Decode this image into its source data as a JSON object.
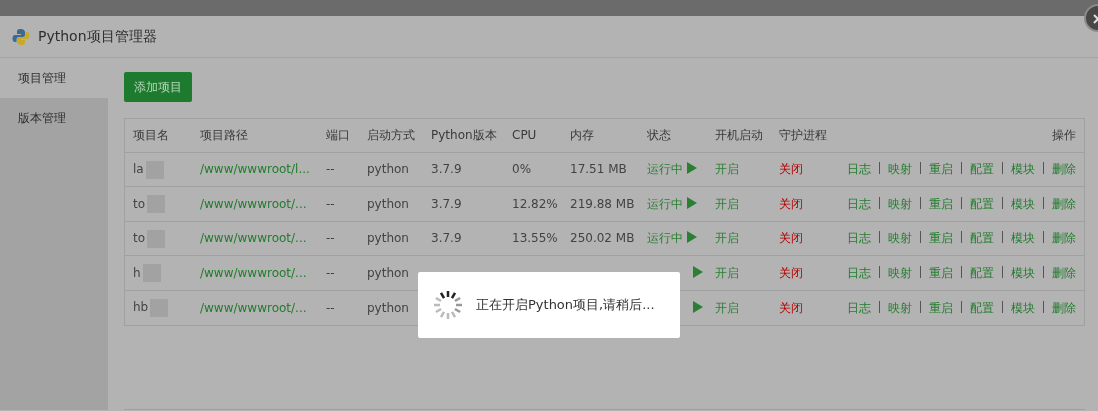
{
  "window": {
    "title": "Python项目管理器"
  },
  "sidebar": {
    "items": [
      {
        "label": "项目管理",
        "selected": true
      },
      {
        "label": "版本管理",
        "selected": false
      }
    ]
  },
  "add_button": "添加项目",
  "table": {
    "columns": [
      "项目名",
      "项目路径",
      "端口",
      "启动方式",
      "Python版本",
      "CPU",
      "内存",
      "状态",
      "开机启动",
      "守护进程",
      "操作"
    ],
    "rows": [
      {
        "name": "la",
        "path": "/www/wwwroot/l...",
        "port": "--",
        "start_mode": "python",
        "version": "3.7.9",
        "cpu": "0%",
        "memory": "17.51 MB",
        "status": "运行中",
        "running": true,
        "autostart": "开启",
        "daemon": "关闭",
        "actions": [
          "日志",
          "映射",
          "重启",
          "配置",
          "模块",
          "删除"
        ]
      },
      {
        "name": "to",
        "path": "/www/wwwroot/...",
        "port": "--",
        "start_mode": "python",
        "version": "3.7.9",
        "cpu": "12.82%",
        "memory": "219.88 MB",
        "status": "运行中",
        "running": true,
        "autostart": "开启",
        "daemon": "关闭",
        "actions": [
          "日志",
          "映射",
          "重启",
          "配置",
          "模块",
          "删除"
        ]
      },
      {
        "name": "to",
        "path": "/www/wwwroot/...",
        "port": "--",
        "start_mode": "python",
        "version": "3.7.9",
        "cpu": "13.55%",
        "memory": "250.02 MB",
        "status": "运行中",
        "running": true,
        "autostart": "开启",
        "daemon": "关闭",
        "actions": [
          "日志",
          "映射",
          "重启",
          "配置",
          "模块",
          "删除"
        ]
      },
      {
        "name": "h",
        "path": "/www/wwwroot/...",
        "port": "--",
        "start_mode": "python",
        "running": true,
        "autostart": "开启",
        "daemon": "关闭",
        "actions": [
          "日志",
          "映射",
          "重启",
          "配置",
          "模块",
          "删除"
        ]
      },
      {
        "name": "hb",
        "path": "/www/wwwroot/...",
        "port": "--",
        "start_mode": "python",
        "running": true,
        "autostart": "开启",
        "daemon": "关闭",
        "actions": [
          "日志",
          "映射",
          "重启",
          "配置",
          "模块",
          "删除"
        ]
      }
    ]
  },
  "toast": {
    "message": "正在开启Python项目,请稍后..."
  }
}
